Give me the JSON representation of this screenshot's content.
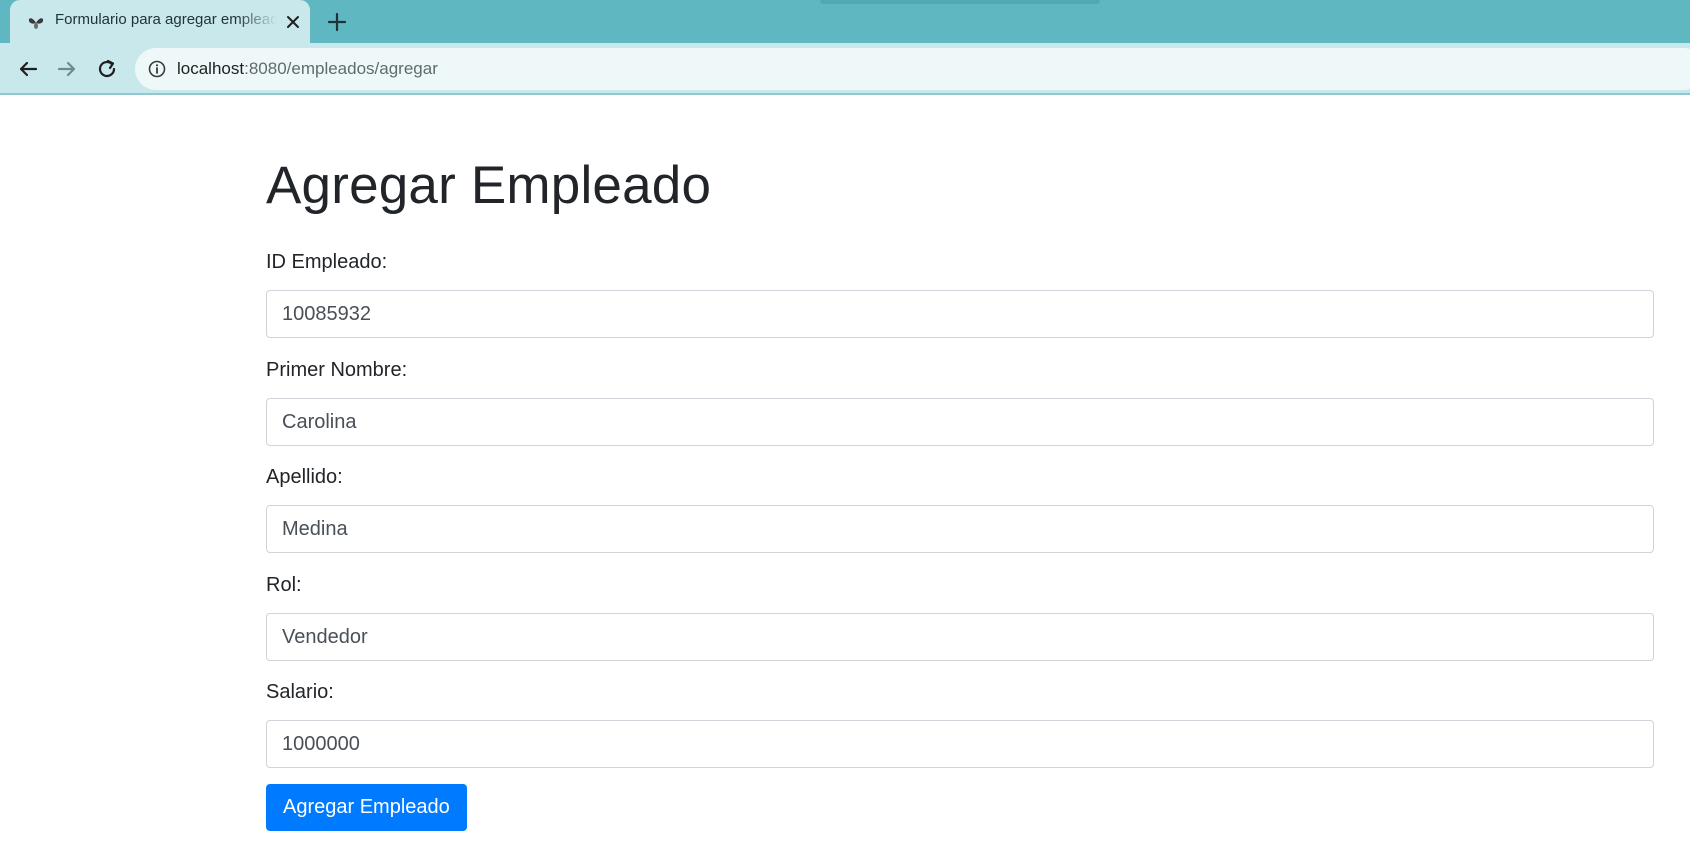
{
  "browser": {
    "tab_title": "Formulario para agregar empleados",
    "url_host": "localhost",
    "url_path": ":8080/empleados/agregar",
    "tab_color": "#c9e8ec",
    "frame_color": "#5fb7c1"
  },
  "page": {
    "heading": "Agregar Empleado",
    "fields": [
      {
        "label": "ID Empleado:",
        "value": "10085932"
      },
      {
        "label": "Primer Nombre:",
        "value": "Carolina"
      },
      {
        "label": "Apellido:",
        "value": "Medina"
      },
      {
        "label": "Rol:",
        "value": "Vendedor"
      },
      {
        "label": "Salario:",
        "value": "1000000"
      }
    ],
    "submit_label": "Agregar Empleado",
    "accent_color": "#007bff"
  },
  "icons": [
    "favicon-icon",
    "close-icon",
    "plus-icon",
    "back-arrow-icon",
    "forward-arrow-icon",
    "reload-icon",
    "info-icon"
  ]
}
